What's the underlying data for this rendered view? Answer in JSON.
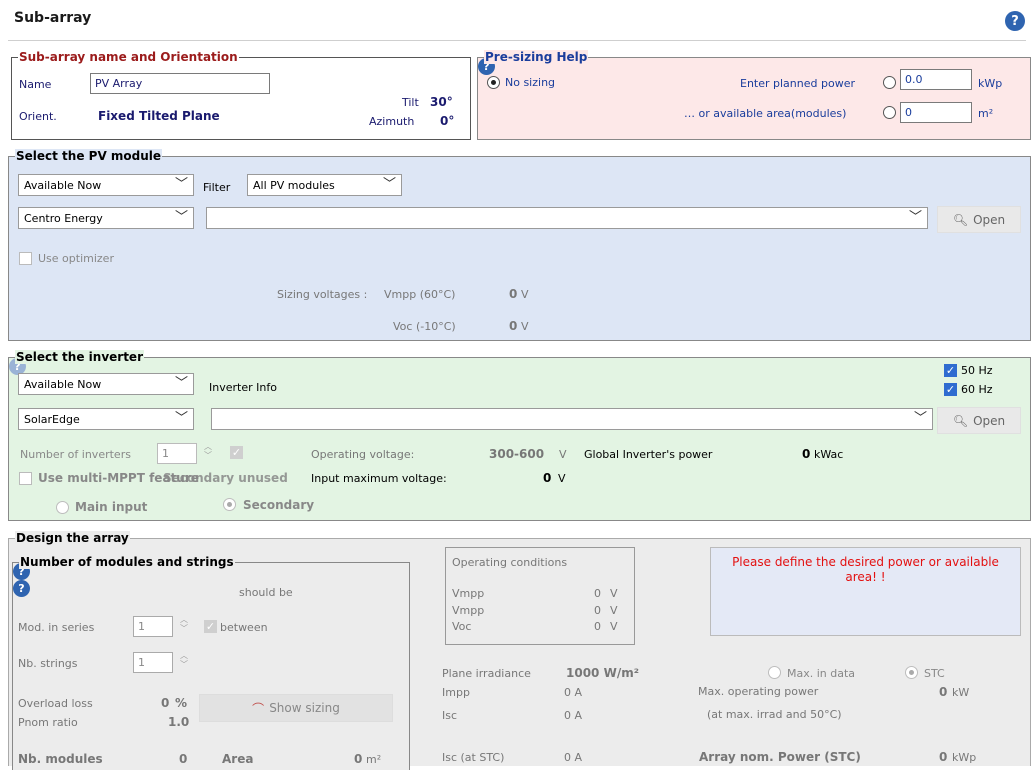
{
  "header": {
    "title": "Sub-array",
    "help": "?"
  },
  "subarray": {
    "legend": "Sub-array name and Orientation",
    "name_label": "Name",
    "name_value": "PV Array",
    "orient_label": "Orient.",
    "orient_value": "Fixed Tilted Plane",
    "tilt_label": "Tilt",
    "tilt_value": "30°",
    "azimuth_label": "Azimuth",
    "azimuth_value": "0°"
  },
  "presizing": {
    "legend": "Pre-sizing Help",
    "no_sizing": "No sizing",
    "planned_label": "Enter planned power",
    "planned_value": "0.0",
    "planned_unit": "kWp",
    "area_label": "… or available area(modules)",
    "area_value": "0",
    "area_unit": "m²",
    "help": "?"
  },
  "pvmodule": {
    "legend": "Select the PV module",
    "availability": "Available Now",
    "filter_label": "Filter",
    "filter_value": "All PV modules",
    "manufacturer": "Centro Energy",
    "model": "",
    "open_label": "Open",
    "use_optimizer": "Use optimizer",
    "sizing_label": "Sizing voltages :",
    "vmpp_label": "Vmpp (60°C)",
    "vmpp_value": "0",
    "vmpp_unit": "V",
    "voc_label": "Voc  (-10°C)",
    "voc_value": "0",
    "voc_unit": "V"
  },
  "inverter": {
    "legend": "Select the inverter",
    "availability": "Available Now",
    "info_label": "Inverter Info",
    "hz50": "50 Hz",
    "hz60": "60 Hz",
    "manufacturer": "SolarEdge",
    "model": "",
    "open_label": "Open",
    "nb_label": "Number of inverters",
    "nb_value": "1",
    "op_voltage_label": "Operating voltage:",
    "op_voltage_value": "300-600",
    "op_voltage_unit": "V",
    "global_label": "Global Inverter's power",
    "global_value": "0",
    "global_unit": "kWac",
    "multi_mppt": "Use multi-MPPT feature",
    "secondary_unused": "Secondary unused",
    "input_max_label": "Input maximum voltage:",
    "input_max_value": "0",
    "input_max_unit": "V",
    "main_input": "Main input",
    "secondary": "Secondary",
    "help": "?"
  },
  "design": {
    "legend": "Design the array",
    "nms_legend": "Number of modules and strings",
    "should_be": "should be",
    "help": "?",
    "mod_series_label": "Mod. in series",
    "mod_series_value": "1",
    "between": "between",
    "nb_strings_label": "Nb. strings",
    "nb_strings_value": "1",
    "overload_label": "Overload loss",
    "overload_value": "0",
    "overload_unit": "%",
    "pnom_label": "Pnom ratio",
    "pnom_value": "1.0",
    "show_sizing": "Show sizing",
    "nb_modules_label": "Nb. modules",
    "nb_modules_value": "0",
    "area_label": "Area",
    "area_value": "0",
    "area_unit": "m²",
    "opcond": {
      "legend": "Operating conditions",
      "rows": [
        {
          "label": "Vmpp",
          "value": "0",
          "unit": "V"
        },
        {
          "label": "Vmpp",
          "value": "0",
          "unit": "V"
        },
        {
          "label": "Voc",
          "value": "0",
          "unit": "V"
        }
      ]
    },
    "message": "Please define the desired power or available area! !",
    "irr_label": "Plane irradiance",
    "irr_value": "1000 W/m²",
    "max_in_data": "Max. in data",
    "stc": "STC",
    "impp_label": "Impp",
    "impp_value": "0 A",
    "isc_label": "Isc",
    "isc_value": "0 A",
    "max_op_label": "Max. operating power",
    "max_op_value": "0",
    "max_op_unit": "kW",
    "max_op_note": "(at max. irrad and 50°C)",
    "isc_stc_label": "Isc (at STC)",
    "isc_stc_value": "0 A",
    "nom_power_label": "Array nom. Power (STC)",
    "nom_power_value": "0",
    "nom_power_unit": "kWp"
  },
  "colors": {
    "presizing_bg": "#fde8e8",
    "pvmodule_bg": "#dde6f5",
    "inverter_bg": "#e3f4e3",
    "design_bg": "#ececec"
  }
}
